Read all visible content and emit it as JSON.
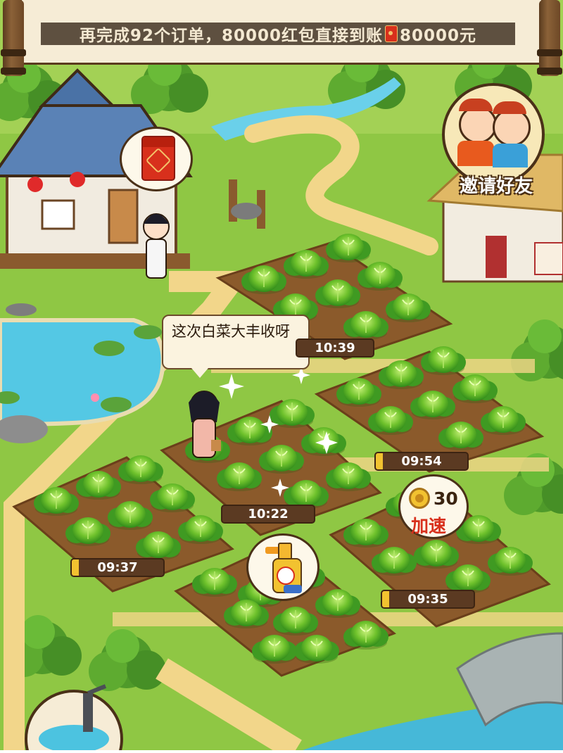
{
  "banner": {
    "text": "再完成92个订单，80000红包直接到账",
    "reward": "80000元"
  },
  "speech": {
    "text": "这次白菜大丰收呀"
  },
  "invite": {
    "label": "邀请好友"
  },
  "speed_up": {
    "coins": "30",
    "label": "加速"
  },
  "timers": [
    {
      "id": "plot-top",
      "time": "10:39",
      "progress": 0.0
    },
    {
      "id": "plot-right",
      "time": "09:54",
      "progress": 0.1
    },
    {
      "id": "plot-center",
      "time": "10:22",
      "progress": 0.0
    },
    {
      "id": "plot-left",
      "time": "09:37",
      "progress": 0.1
    },
    {
      "id": "plot-bottom-right",
      "time": "09:35",
      "progress": 0.1
    }
  ],
  "icons": [
    "red-packet-icon",
    "pesticide-spray-icon",
    "coin-icon",
    "friends-avatar-icon",
    "water-pump-icon"
  ],
  "colors": {
    "grass": "#8cc63f",
    "soil": "#8b5a2b",
    "path": "#f0d080",
    "water": "#4cc3e0",
    "accent_red": "#d8301c"
  }
}
